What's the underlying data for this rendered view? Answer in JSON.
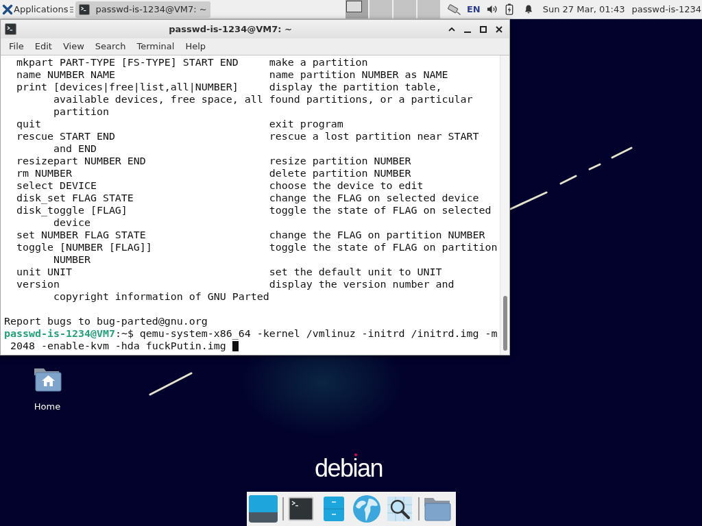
{
  "top_panel": {
    "applications_label": "Applications",
    "tasks": [
      {
        "title": "passwd-is-1234@VM7: ~",
        "selected": true
      }
    ],
    "workspaces": [
      {
        "selected": true
      },
      {
        "selected": false
      },
      {
        "selected": false
      },
      {
        "selected": false
      }
    ],
    "keyboard_layout": "EN",
    "clock": "Sun 27 Mar, 01:43",
    "user": "passwd-is-1234"
  },
  "terminal_window": {
    "title": "passwd-is-1234@VM7: ~",
    "menu": [
      "File",
      "Edit",
      "View",
      "Search",
      "Terminal",
      "Help"
    ],
    "lines": [
      {
        "kind": "entry",
        "command": "mkpart PART-TYPE [FS-TYPE] START END",
        "description": "make a partition"
      },
      {
        "kind": "entry",
        "command": "name NUMBER NAME",
        "description": "name partition NUMBER as NAME"
      },
      {
        "kind": "entry",
        "command": "print [devices|free|list,all|NUMBER]",
        "description": "display the partition table,"
      },
      {
        "kind": "wrap",
        "command": "available devices, free space, all",
        "description": "found partitions, or a particular"
      },
      {
        "kind": "wrap",
        "command": "partition"
      },
      {
        "kind": "entry",
        "command": "quit",
        "description": "exit program"
      },
      {
        "kind": "entry",
        "command": "rescue START END",
        "description": "rescue a lost partition near START"
      },
      {
        "kind": "wrap",
        "command": "and END"
      },
      {
        "kind": "entry",
        "command": "resizepart NUMBER END",
        "description": "resize partition NUMBER"
      },
      {
        "kind": "entry",
        "command": "rm NUMBER",
        "description": "delete partition NUMBER"
      },
      {
        "kind": "entry",
        "command": "select DEVICE",
        "description": "choose the device to edit"
      },
      {
        "kind": "entry",
        "command": "disk_set FLAG STATE",
        "description": "change the FLAG on selected device"
      },
      {
        "kind": "entry",
        "command": "disk_toggle [FLAG]",
        "description": "toggle the state of FLAG on selected"
      },
      {
        "kind": "wrap",
        "command": "device"
      },
      {
        "kind": "entry",
        "command": "set NUMBER FLAG STATE",
        "description": "change the FLAG on partition NUMBER"
      },
      {
        "kind": "entry",
        "command": "toggle [NUMBER [FLAG]]",
        "description": "toggle the state of FLAG on partition"
      },
      {
        "kind": "wrap",
        "command": "NUMBER"
      },
      {
        "kind": "entry",
        "command": "unit UNIT",
        "description": "set the default unit to UNIT"
      },
      {
        "kind": "entry",
        "command": "version",
        "description": "display the version number and"
      },
      {
        "kind": "wrap",
        "command": "copyright information of GNU Parted"
      },
      {
        "kind": "blank"
      },
      {
        "kind": "text",
        "text": "Report bugs to bug-parted@gnu.org"
      }
    ],
    "prompt": {
      "user_host": "passwd-is-1234@VM7",
      "path": ":~$",
      "command_lines": [
        "qemu-system-x86_64 -kernel /vmlinuz -initrd /initrd.img -m",
        "2048 -enable-kvm -hda fuckPutin.img"
      ]
    }
  },
  "desktop": {
    "icons": [
      {
        "label": "Home"
      }
    ],
    "logo": "debian"
  }
}
